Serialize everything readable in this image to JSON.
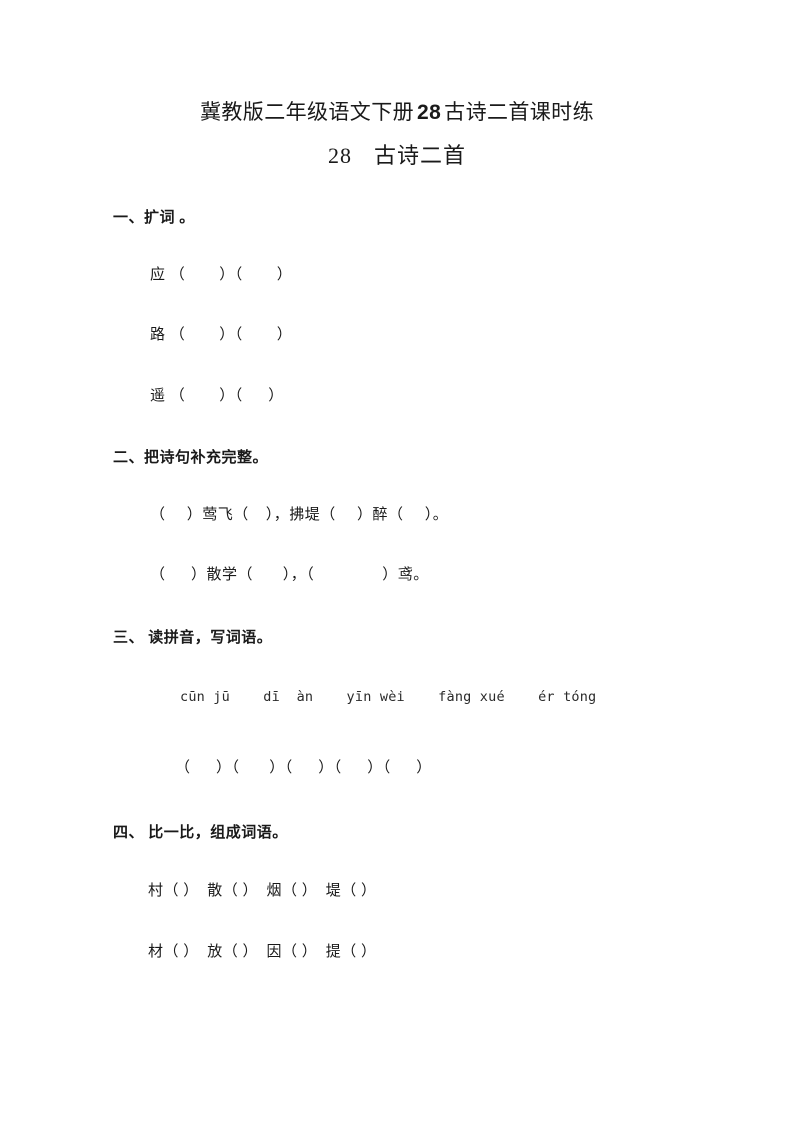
{
  "document": {
    "title_prefix": "冀教版二年级语文下册",
    "title_number": "28",
    "title_suffix": "古诗二首课时练",
    "subtitle_number": "28",
    "subtitle_text": "古诗二首"
  },
  "sections": [
    {
      "heading": "一、扩词 。",
      "rows": [
        "应 （        ）（        ）",
        "路 （        ）（        ）",
        "遥 （        ）（      ）"
      ]
    },
    {
      "heading": "二、把诗句补充完整。",
      "rows": [
        "（     ）莺飞（    ），拂堤（     ）醉（     ）。",
        "（      ）散学（       ），（                ）鸢。"
      ]
    },
    {
      "heading": "三、 读拼音，写词语。",
      "pinyin": "cūn jū    dī  àn    yīn wèi    fàng xué    ér tóng",
      "pinyin_words": [
        "cūn jū",
        "dī àn",
        "yīn wèi",
        "fàng xué",
        "ér tóng"
      ],
      "answer_row": "（      ）（       ）（      ）（      ）（      ）"
    },
    {
      "heading": "四、 比一比，组成词语。",
      "rows": [
        "村（ ）  散（ ）  烟（ ）  堤（ ）",
        "材（ ）  放（ ）  因（ ）  提（ ）"
      ],
      "pairs": [
        [
          "村",
          "材"
        ],
        [
          "散",
          "放"
        ],
        [
          "烟",
          "因"
        ],
        [
          "堤",
          "提"
        ]
      ]
    }
  ]
}
